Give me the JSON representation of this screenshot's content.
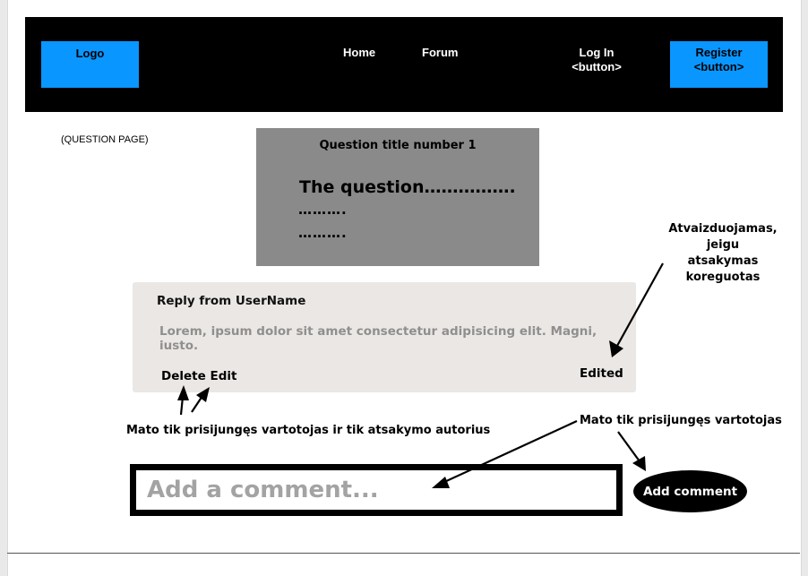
{
  "nav": {
    "logo_label": "Logo",
    "home_label": "Home",
    "forum_label": "Forum",
    "login_line1": "Log In",
    "login_line2": "<button>",
    "register_line1": "Register",
    "register_line2": "<button>",
    "accent_color": "#0a96ff"
  },
  "page_label": "(QUESTION PAGE)",
  "question": {
    "title": "Question title number 1",
    "body": "The question…………….",
    "dots_line1": "……….",
    "dots_line2": "………."
  },
  "reply": {
    "author": "Reply from UserName",
    "text": "Lorem, ipsum dolor sit amet consectetur adipisicing elit. Magni, iusto.",
    "delete_label": "Delete",
    "edit_label": "Edit",
    "edited_label": "Edited"
  },
  "annotations": {
    "edited_note_line1": "Atvaizduojamas, jeigu",
    "edited_note_line2": "atsakymas koreguotas",
    "author_note": "Mato tik prisijungęs vartotojas ir tik atsakymo autorius",
    "logged_note": "Mato tik prisijungęs vartotojas"
  },
  "comment": {
    "placeholder": "Add a comment...",
    "button_label": "Add comment"
  }
}
